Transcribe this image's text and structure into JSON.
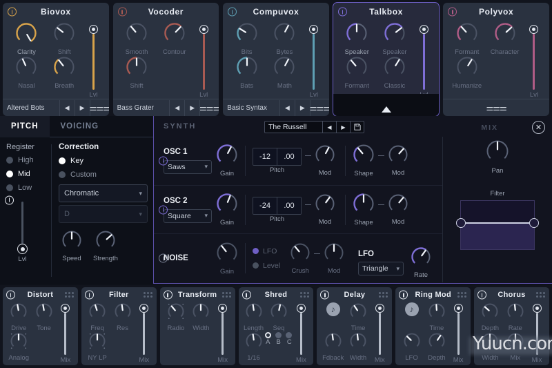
{
  "top_modules": [
    {
      "name": "Biovox",
      "power": "on-gold",
      "accent": "#d8a34a",
      "selected": false,
      "knobs": [
        {
          "label": "Clarity",
          "angle": 150,
          "arc": true,
          "dim": false
        },
        {
          "label": "Shift",
          "angle": -52,
          "arc": false,
          "dim": true
        },
        {
          "label": "Nasal",
          "angle": -24,
          "arc": false,
          "dim": true
        },
        {
          "label": "Breath",
          "angle": -38,
          "arc": true,
          "dim": true
        }
      ],
      "slider": {
        "label": "Lvl",
        "value": 100
      },
      "preset": "Altered Bots",
      "prev": "◀",
      "next": "▶",
      "edit_icon": "sliders-icon"
    },
    {
      "name": "Vocoder",
      "power": "on-red",
      "accent": "#a85a52",
      "selected": false,
      "knobs": [
        {
          "label": "Smooth",
          "angle": -40,
          "arc": false,
          "dim": true
        },
        {
          "label": "Contour",
          "angle": 44,
          "arc": true,
          "dim": true
        },
        {
          "label": "Shift",
          "angle": 0,
          "arc": true,
          "dim": true
        },
        {
          "label": "",
          "angle": 0,
          "arc": false,
          "dim": true
        }
      ],
      "slider": {
        "label": "Lvl",
        "value": 100
      },
      "preset": "Bass Grater",
      "prev": "◀",
      "next": "▶",
      "edit_icon": "sliders-icon"
    },
    {
      "name": "Compuvox",
      "power": "on-cyan",
      "accent": "#5e9fb3",
      "selected": false,
      "knobs": [
        {
          "label": "Bits",
          "angle": -58,
          "arc": true,
          "dim": true
        },
        {
          "label": "Bytes",
          "angle": 28,
          "arc": false,
          "dim": true
        },
        {
          "label": "Bats",
          "angle": 0,
          "arc": true,
          "dim": true
        },
        {
          "label": "Math",
          "angle": 28,
          "arc": false,
          "dim": true
        }
      ],
      "slider": {
        "label": "Lvl",
        "value": 100
      },
      "preset": "Basic Syntax",
      "prev": "◀",
      "next": "▶",
      "edit_icon": "sliders-icon"
    },
    {
      "name": "Talkbox",
      "power": "on-purple",
      "accent": "#7e6ed6",
      "selected": true,
      "knobs": [
        {
          "label": "Speaker",
          "angle": 0,
          "arc": true,
          "dim": false
        },
        {
          "label": "Speaker",
          "angle": 52,
          "arc": true,
          "dim": true
        },
        {
          "label": "Formant",
          "angle": -40,
          "arc": false,
          "dim": true
        },
        {
          "label": "Classic",
          "angle": 32,
          "arc": false,
          "dim": true
        }
      ],
      "slider": {
        "label": "Lvl",
        "value": 100
      },
      "preset": "",
      "prev": "",
      "next": "",
      "edit_icon": "expand-arrow"
    },
    {
      "name": "Polyvox",
      "power": "on-pink",
      "accent": "#b05c86",
      "selected": false,
      "knobs": [
        {
          "label": "Formant",
          "angle": -42,
          "arc": true,
          "dim": true
        },
        {
          "label": "Character",
          "angle": 48,
          "arc": true,
          "dim": true
        },
        {
          "label": "Humanize",
          "angle": 32,
          "arc": false,
          "dim": true
        },
        {
          "label": "",
          "angle": 0,
          "arc": false,
          "dim": true
        }
      ],
      "slider": {
        "label": "Lvl",
        "value": 100
      },
      "preset": "",
      "prev": "",
      "next": "",
      "edit_icon": "sliders-icon"
    }
  ],
  "pitch_panel": {
    "tabs": [
      {
        "label": "PITCH",
        "active": true
      },
      {
        "label": "VOICING",
        "active": false
      }
    ],
    "register": {
      "label": "Register",
      "options": [
        {
          "label": "High",
          "selected": false
        },
        {
          "label": "Mid",
          "selected": true
        },
        {
          "label": "Low",
          "selected": false
        }
      ]
    },
    "level": {
      "label": "Lvl",
      "value": 0
    },
    "correction": {
      "title": "Correction",
      "power": "on-white",
      "modes": [
        {
          "label": "Key",
          "selected": true
        },
        {
          "label": "Custom",
          "selected": false
        }
      ],
      "scale_select": {
        "value": "Chromatic",
        "enabled": true
      },
      "note_select": {
        "value": "D",
        "enabled": false
      },
      "knobs": [
        {
          "label": "Speed",
          "angle": 0
        },
        {
          "label": "Strength",
          "angle": 48
        }
      ]
    }
  },
  "synth": {
    "label": "SYNTH",
    "preset": {
      "value": "The Russell",
      "prev": "◀",
      "next": "▶",
      "save_icon": "save-disk-icon"
    },
    "mix_label": "MIX",
    "close_icon": "✕",
    "osc1": {
      "power": "on-purple",
      "name": "OSC 1",
      "wave": "Saws",
      "gain": {
        "label": "Gain",
        "angle": 28,
        "arc": true
      },
      "pitch": {
        "label": "Pitch",
        "semitones": "-12",
        "cents": ".00"
      },
      "pitch_mod": {
        "label": "Mod",
        "angle": 28,
        "arc": false
      },
      "shape": {
        "label": "Shape",
        "angle": -40,
        "arc": true
      },
      "shape_mod": {
        "label": "Mod",
        "angle": 42,
        "arc": false
      }
    },
    "osc2": {
      "power": "on-purple",
      "name": "OSC 2",
      "wave": "Square",
      "gain": {
        "label": "Gain",
        "angle": 22,
        "arc": true
      },
      "pitch": {
        "label": "Pitch",
        "semitones": "-24",
        "cents": ".00"
      },
      "pitch_mod": {
        "label": "Mod",
        "angle": 36,
        "arc": false
      },
      "shape": {
        "label": "Shape",
        "angle": 0,
        "arc": true
      },
      "shape_mod": {
        "label": "Mod",
        "angle": 40,
        "arc": false
      }
    },
    "noise": {
      "power": "off",
      "name": "NOISE",
      "gain": {
        "label": "Gain",
        "angle": -38,
        "arc": false
      },
      "targets": [
        {
          "label": "LFO",
          "selected": true
        },
        {
          "label": "Level",
          "selected": false
        }
      ],
      "crush": {
        "label": "Crush",
        "angle": -40,
        "arc": false
      },
      "crush_mod": {
        "label": "Mod",
        "angle": 0,
        "arc": false
      }
    },
    "lfo": {
      "title": "LFO",
      "shape": "Triangle",
      "rate": {
        "label": "Rate",
        "angle": 36,
        "arc": true
      }
    },
    "mix": {
      "pan": {
        "label": "Pan",
        "angle": 0,
        "arc": false
      },
      "filter": {
        "label": "Filter"
      }
    }
  },
  "fx_modules": [
    {
      "name": "Distort",
      "power": "on-white",
      "knobs": [
        {
          "label": "Drive",
          "angle": -10
        },
        {
          "label": "Tone",
          "angle": -10
        },
        {
          "label": "Analog",
          "angle": 0,
          "dots": true
        }
      ],
      "slider": {
        "label": "Mix",
        "value": 100
      }
    },
    {
      "name": "Filter",
      "power": "on-white",
      "knobs": [
        {
          "label": "Freq",
          "angle": -18
        },
        {
          "label": "Res",
          "angle": -8
        },
        {
          "label": "NY LP",
          "angle": 0,
          "dots": true
        }
      ],
      "slider": {
        "label": "Mix",
        "value": 100
      }
    },
    {
      "name": "Transform",
      "power": "on-white",
      "knobs": [
        {
          "label": "Radio",
          "angle": -40,
          "dots": true
        },
        {
          "label": "Width",
          "angle": 0
        }
      ],
      "slider": {
        "label": "Mix",
        "value": 100
      }
    },
    {
      "name": "Shred",
      "power": "on-white",
      "knobs": [
        {
          "label": "Length",
          "angle": -8
        },
        {
          "label": "Seq",
          "angle": 12
        },
        {
          "label": "1/16",
          "angle": -8
        }
      ],
      "abc": {
        "options": [
          "A",
          "B",
          "C"
        ],
        "selected": "A"
      },
      "slider": {
        "label": "Mix",
        "value": 100
      }
    },
    {
      "name": "Delay",
      "power": "on-white",
      "note_icon": "note-sync-icon",
      "knobs": [
        {
          "label": "Time",
          "angle": -34
        },
        {
          "label": "Fdback",
          "angle": -8
        },
        {
          "label": "Width",
          "angle": -6
        }
      ],
      "slider": {
        "label": "Mix",
        "value": 100
      }
    },
    {
      "name": "Ring Mod",
      "power": "on-white",
      "note_icon": "note-sync-icon",
      "knobs": [
        {
          "label": "Time",
          "angle": -4
        },
        {
          "label": "LFO",
          "angle": -46
        },
        {
          "label": "Depth",
          "angle": 34
        }
      ],
      "slider": {
        "label": "Mix",
        "value": 100
      }
    },
    {
      "name": "Chorus",
      "power": "on-white",
      "knobs": [
        {
          "label": "Depth",
          "angle": -48
        },
        {
          "label": "Rate",
          "angle": -6
        },
        {
          "label": "Width",
          "angle": 0
        },
        {
          "label": "Mix",
          "angle": 0
        }
      ],
      "slider": {
        "label": "Mix",
        "value": 100
      }
    }
  ],
  "watermark": "Yuucn.com"
}
